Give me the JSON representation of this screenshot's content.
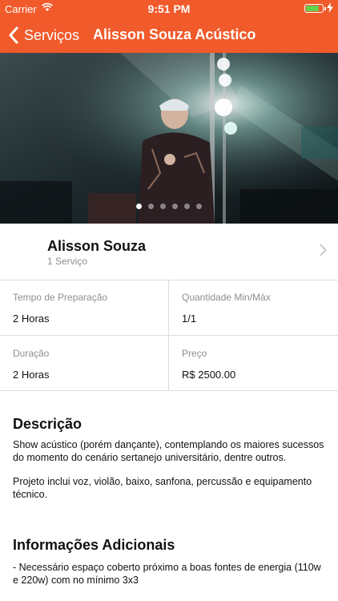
{
  "status_bar": {
    "carrier": "Carrier",
    "time": "9:51 PM",
    "battery_level": 0.85
  },
  "nav": {
    "back_label": "Serviços",
    "title": "Alisson Souza Acústico"
  },
  "gallery": {
    "page_count": 6,
    "active_index": 0
  },
  "artist": {
    "name": "Alisson Souza",
    "services": "1 Serviço"
  },
  "details": {
    "prep_label": "Tempo de Preparação",
    "prep_value": "2 Horas",
    "qty_label": "Quantidade Min/Máx",
    "qty_value": "1/1",
    "duration_label": "Duração",
    "duration_value": "2 Horas",
    "price_label": "Preço",
    "price_value": "R$ 2500.00"
  },
  "description": {
    "heading": "Descrição",
    "paragraph1": "Show acústico (porém dançante), contemplando os maiores sucessos do momento do cenário sertanejo universitário, dentre outros.",
    "paragraph2": "Projeto inclui voz, violão, baixo, sanfona, percussão e equipamento técnico."
  },
  "additional": {
    "heading": "Informações Adicionais",
    "line1": "- Necessário espaço coberto próximo a boas fontes de energia (110w e 220w) com no mínimo 3x3"
  },
  "colors": {
    "accent": "#f15a2b",
    "battery": "#62d24e"
  }
}
